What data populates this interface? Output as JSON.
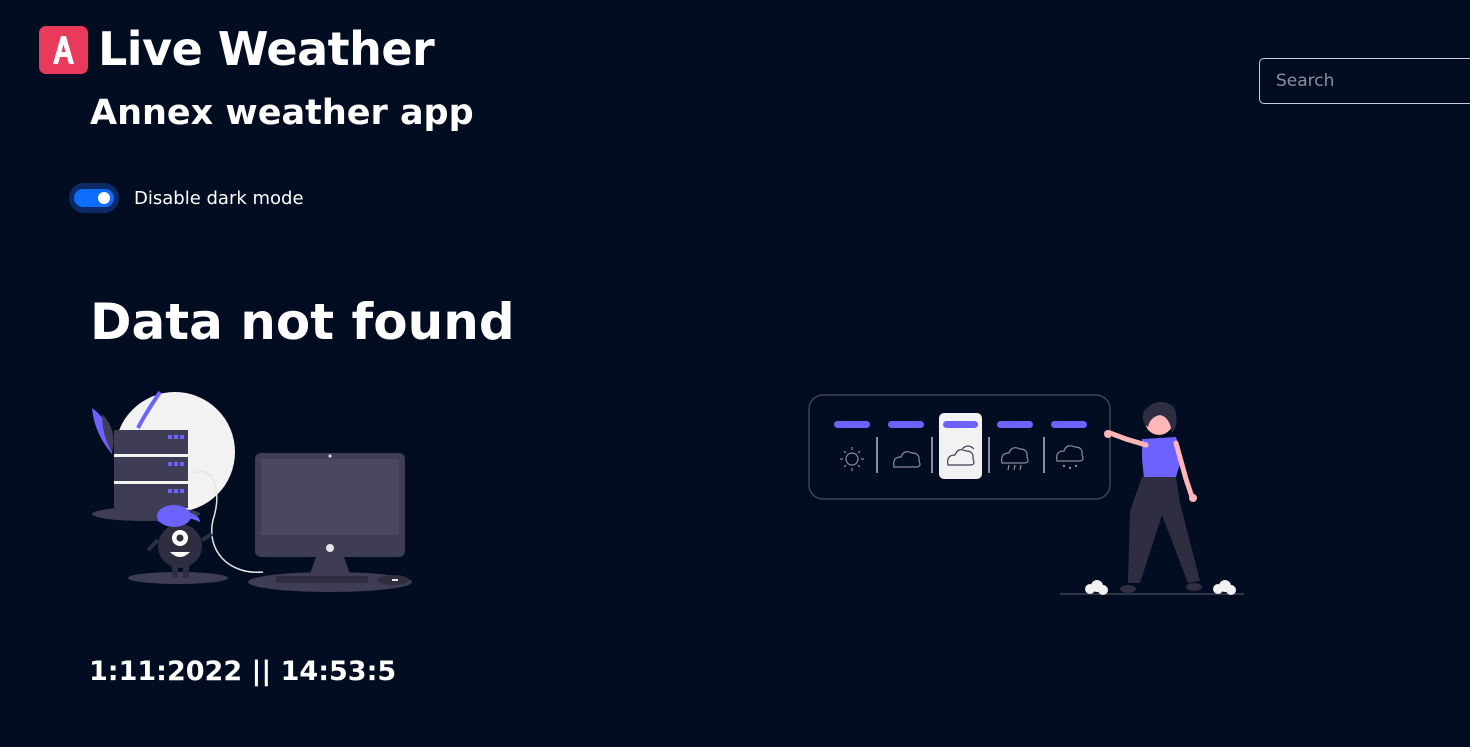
{
  "header": {
    "logo_icon": "app-logo-a-icon",
    "logo_letter": "A",
    "title": "Live Weather",
    "subtitle": "Annex weather app"
  },
  "search": {
    "placeholder": "Search",
    "value": ""
  },
  "theme_toggle": {
    "label": "Disable dark mode",
    "checked": true
  },
  "status": {
    "message": "Data not found"
  },
  "footer": {
    "datetime": "1:11:2022 || 14:53:5"
  },
  "colors": {
    "background": "#020d21",
    "brand": "#ea3a5c",
    "toggle_on": "#0d6efd",
    "illustration_accent": "#6c63ff"
  },
  "illustrations": {
    "left": "server-and-computer-error-illustration",
    "right": "woman-pointing-at-weather-forecast-panel-illustration"
  }
}
